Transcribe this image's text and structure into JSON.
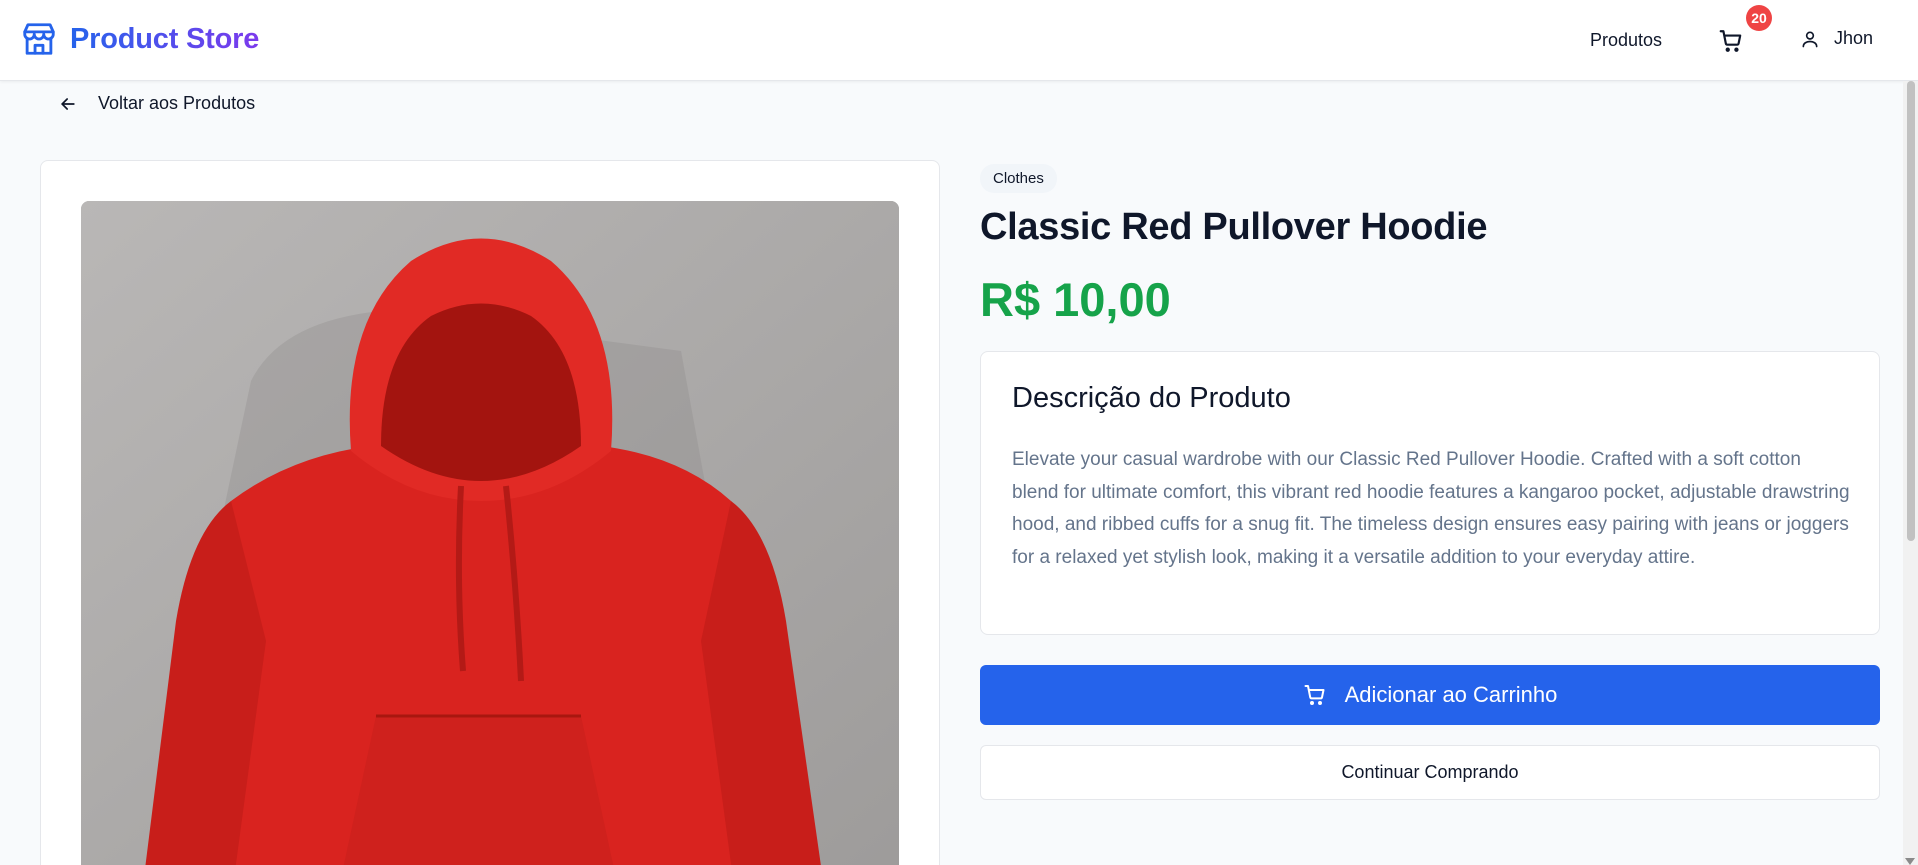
{
  "header": {
    "brand": "Product Store",
    "nav_produtos": "Produtos",
    "cart_count": "20",
    "user_name": "Jhon"
  },
  "back": {
    "label": "Voltar aos Produtos"
  },
  "product": {
    "category": "Clothes",
    "title": "Classic Red Pullover Hoodie",
    "price": "R$ 10,00",
    "image_alt": "red hoodie photo"
  },
  "description": {
    "heading": "Descrição do Produto",
    "text": "Elevate your casual wardrobe with our Classic Red Pullover Hoodie. Crafted with a soft cotton blend for ultimate comfort, this vibrant red hoodie features a kangaroo pocket, adjustable drawstring hood, and ribbed cuffs for a snug fit. The timeless design ensures easy pairing with jeans or joggers for a relaxed yet stylish look, making it a versatile addition to your everyday attire."
  },
  "actions": {
    "add_to_cart": "Adicionar ao Carrinho",
    "continue_shopping": "Continuar Comprando"
  },
  "colors": {
    "accent": "#2563eb",
    "price": "#16a34a",
    "badge": "#ef4444",
    "brand_gradient": [
      "#2563eb",
      "#7c3aed"
    ]
  },
  "icons": {
    "brand": "store-icon",
    "cart": "cart-icon",
    "user": "user-icon",
    "back": "arrow-left-icon"
  }
}
